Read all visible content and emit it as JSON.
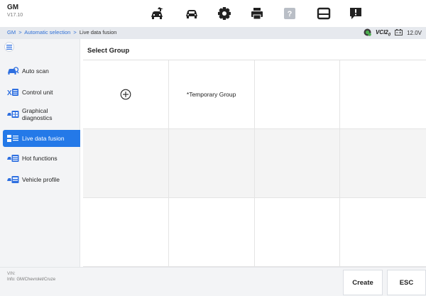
{
  "header": {
    "title": "GM",
    "version": "V17.10",
    "toolbar": [
      {
        "name": "home-icon"
      },
      {
        "name": "vehicle-icon"
      },
      {
        "name": "settings-icon"
      },
      {
        "name": "print-icon"
      },
      {
        "name": "help-icon"
      },
      {
        "name": "save-icon"
      },
      {
        "name": "feedback-icon"
      }
    ]
  },
  "breadcrumb": {
    "parts": [
      "GM",
      "Automatic selection",
      "Live data fusion"
    ],
    "separator": ">"
  },
  "status": {
    "vci_label": "VCI2",
    "vci_subscript": "0",
    "battery": "12.0V"
  },
  "sidebar": {
    "items": [
      {
        "label": "Auto scan",
        "icon": "car-scan-icon",
        "active": false
      },
      {
        "label": "Control unit",
        "icon": "control-unit-icon",
        "active": false
      },
      {
        "label": "Graphical\ndiagnostics",
        "icon": "graphical-diagnostics-icon",
        "active": false
      },
      {
        "label": "Live data fusion",
        "icon": "live-data-icon",
        "active": true
      },
      {
        "label": "Hot functions",
        "icon": "hot-functions-icon",
        "active": false
      },
      {
        "label": "Vehicle profile",
        "icon": "vehicle-profile-icon",
        "active": false
      }
    ]
  },
  "main": {
    "title": "Select Group",
    "grid": [
      [
        "+",
        "*Temporary Group",
        "",
        ""
      ],
      [
        "",
        "",
        "",
        ""
      ],
      [
        "",
        "",
        "",
        ""
      ]
    ]
  },
  "footer": {
    "vin_label": "VIN:",
    "info": "Info: GM/Chevrolet/Cruze",
    "create_label": "Create",
    "esc_label": "ESC"
  },
  "colors": {
    "accent": "#2479e8",
    "link": "#2f6fd6",
    "icon_blue": "#2e6fe0"
  }
}
